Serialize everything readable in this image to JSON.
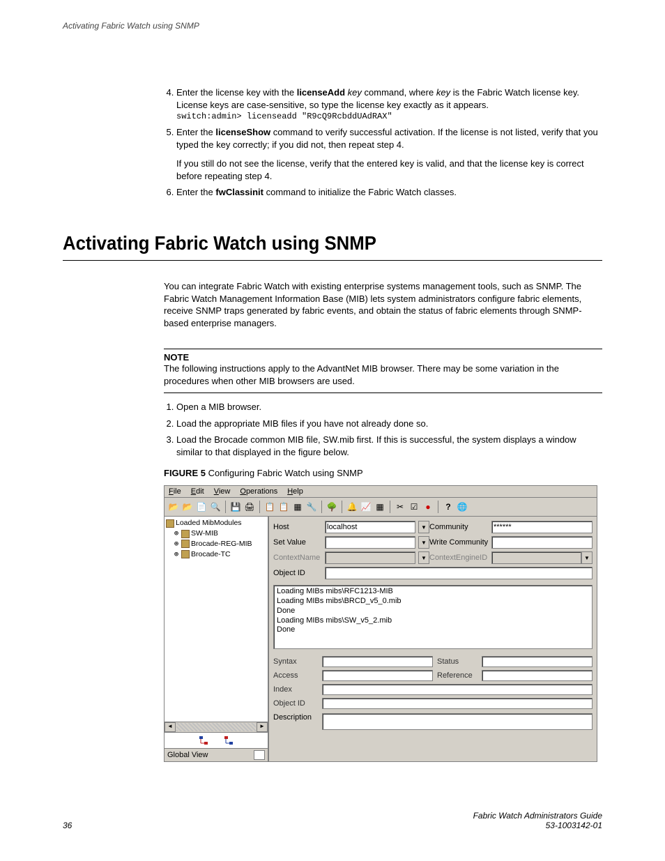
{
  "header": {
    "running": "Activating Fabric Watch using SNMP"
  },
  "stepsA": {
    "start": 4,
    "items": [
      {
        "pre": "Enter the license key with the ",
        "boldA": "licenseAdd ",
        "italA": "key ",
        "mid": "command, where ",
        "italB": "key ",
        "post": "is the Fabric Watch license key. License keys are case-sensitive, so type the license key exactly as it appears.",
        "code": "switch:admin> licenseadd \"R9cQ9RcbddUAdRAX\""
      },
      {
        "pre": "Enter the ",
        "boldA": "licenseShow",
        "post": " command to verify successful activation. If the license is not listed, verify that you typed the key correctly; if you did not, then repeat step 4.",
        "para2": "If you still do not see the license, verify that the entered key is valid, and that the license key is correct before repeating step 4."
      },
      {
        "pre": "Enter the ",
        "boldA": "fwClassinit",
        "post": " command to initialize the Fabric Watch classes."
      }
    ]
  },
  "section": {
    "title": "Activating Fabric Watch using SNMP",
    "intro": "You can integrate Fabric Watch with existing enterprise systems management tools, such as SNMP. The Fabric Watch Management Information Base (MIB) lets system administrators configure fabric elements, receive SNMP traps generated by fabric events, and obtain the status of fabric elements through SNMP-based enterprise managers.",
    "noteLabel": "NOTE",
    "noteBody": "The following instructions apply to the AdvantNet MIB browser. There may be some variation in the procedures when other MIB browsers are used.",
    "stepsB": [
      "Open a MIB browser.",
      "Load the appropriate MIB files if you have not already done so.",
      "Load the Brocade common MIB file, SW.mib first. If this is successful, the system displays a window similar to that displayed in the figure below."
    ],
    "figureLabelBold": "FIGURE 5 ",
    "figureLabelRest": "Configuring Fabric Watch using SNMP"
  },
  "mib": {
    "menus": {
      "file": "File",
      "edit": "Edit",
      "view": "View",
      "ops": "Operations",
      "help": "Help"
    },
    "tree": {
      "root": "Loaded MibModules",
      "children": [
        "SW-MIB",
        "Brocade-REG-MIB",
        "Brocade-TC"
      ]
    },
    "globalView": "Global View",
    "labels": {
      "host": "Host",
      "setValue": "Set Value",
      "contextName": "ContextName",
      "objectId": "Object ID",
      "community": "Community",
      "writeCommunity": "Write Community",
      "contextEngineId": "ContextEngineID",
      "syntax": "Syntax",
      "access": "Access",
      "index": "Index",
      "objectId2": "Object ID",
      "status": "Status",
      "reference": "Reference",
      "description": "Description"
    },
    "values": {
      "host": "localhost",
      "community": "******"
    },
    "log": [
      "Loading MIBs mibs\\RFC1213-MIB",
      "Loading MIBs mibs\\BRCD_v5_0.mib",
      "Done",
      "Loading MIBs mibs\\SW_v5_2.mib",
      "Done"
    ]
  },
  "footer": {
    "pageNum": "36",
    "guide": "Fabric Watch Administrators Guide",
    "docNum": "53-1003142-01"
  }
}
